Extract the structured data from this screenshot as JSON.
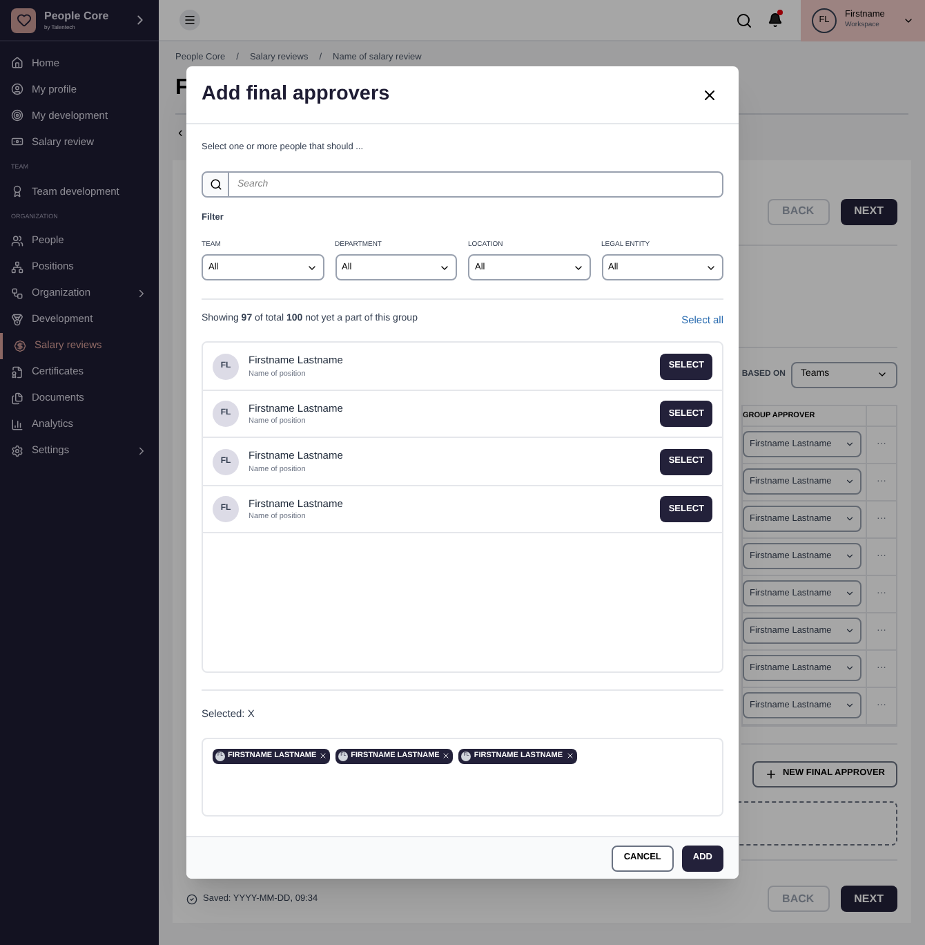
{
  "sidebar": {
    "brand": {
      "name": "People Core",
      "tagline": "by Talentech"
    },
    "sections": [
      {
        "items": [
          {
            "label": "Home",
            "selected": false,
            "expandable": false
          },
          {
            "label": "My profile",
            "selected": false,
            "expandable": false
          },
          {
            "label": "My development",
            "selected": false,
            "expandable": false
          },
          {
            "label": "Salary review",
            "selected": false,
            "expandable": false
          }
        ]
      },
      {
        "heading": "TEAM",
        "items": [
          {
            "label": "Team development",
            "selected": false,
            "expandable": false
          }
        ]
      },
      {
        "heading": "ORGANIZATION",
        "items": [
          {
            "label": "People",
            "selected": false,
            "expandable": false
          },
          {
            "label": "Positions",
            "selected": false,
            "expandable": false
          },
          {
            "label": "Organization",
            "selected": false,
            "expandable": true
          },
          {
            "label": "Development",
            "selected": false,
            "expandable": false
          },
          {
            "label": "Salary reviews",
            "selected": true,
            "expandable": false
          },
          {
            "label": "Certificates",
            "selected": false,
            "expandable": false
          },
          {
            "label": "Documents",
            "selected": false,
            "expandable": false
          },
          {
            "label": "Analytics",
            "selected": false,
            "expandable": false
          },
          {
            "label": "Settings",
            "selected": false,
            "expandable": true
          }
        ]
      }
    ]
  },
  "topbar": {
    "notifications_unread": true,
    "user": {
      "initials": "FL",
      "name": "Firstname",
      "workspace": "Workspace"
    }
  },
  "page": {
    "breadcrumb": [
      "People Core",
      "Salary reviews",
      "Name of salary review"
    ],
    "breadcrumb_separator": "/",
    "title": "F",
    "back": "‹",
    "top_buttons": [
      {
        "label": "BACK",
        "disabled": true
      },
      {
        "label": "NEXT",
        "disabled": false
      }
    ],
    "based_on": {
      "label": "BASED ON",
      "value": "Teams"
    },
    "table": {
      "columns": [
        "GROUP APPROVER"
      ],
      "rows": [
        {
          "approver": "Firstname Lastname",
          "menu": "···"
        },
        {
          "approver": "Firstname Lastname",
          "menu": "···"
        },
        {
          "approver": "Firstname Lastname",
          "menu": "···"
        },
        {
          "approver": "Firstname Lastname",
          "menu": "···"
        },
        {
          "approver": "Firstname Lastname",
          "menu": "···"
        },
        {
          "approver": "Firstname Lastname",
          "menu": "···"
        },
        {
          "approver": "Firstname Lastname",
          "menu": "···"
        },
        {
          "approver": "Firstname Lastname",
          "menu": "···"
        }
      ]
    },
    "new_button": "NEW FINAL APPROVER",
    "saved": "Saved: YYYY-MM-DD, 09:34",
    "bottom_buttons": [
      {
        "label": "BACK",
        "disabled": true
      },
      {
        "label": "NEXT",
        "disabled": false
      }
    ]
  },
  "dialog": {
    "title": "Add final approvers",
    "description": "Select one or more people that should ...",
    "search": {
      "placeholder": "Search"
    },
    "filter_title": "Filter",
    "filters": [
      {
        "label": "TEAM",
        "value": "All"
      },
      {
        "label": "DEPARTMENT",
        "value": "All"
      },
      {
        "label": "LOCATION",
        "value": "All"
      },
      {
        "label": "LEGAL ENTITY",
        "value": "All"
      }
    ],
    "summary": "Showing **97** of total **100** not yet a part of this group",
    "select_all": "Select all",
    "people": [
      {
        "initials": "FL",
        "name": "Firstname Lastname",
        "position": "Name of position",
        "action": "SELECT"
      },
      {
        "initials": "FL",
        "name": "Firstname Lastname",
        "position": "Name of position",
        "action": "SELECT"
      },
      {
        "initials": "FL",
        "name": "Firstname Lastname",
        "position": "Name of position",
        "action": "SELECT"
      },
      {
        "initials": "FL",
        "name": "Firstname Lastname",
        "position": "Name of position",
        "action": "SELECT"
      }
    ],
    "selected_label": "Selected: X",
    "chips": [
      {
        "initials": "FL",
        "name": "FIRSTNAME LASTNAME"
      },
      {
        "initials": "FL",
        "name": "FIRSTNAME LASTNAME"
      },
      {
        "initials": "FL",
        "name": "FIRSTNAME LASTNAME"
      }
    ],
    "buttons": [
      {
        "label": "CANCEL",
        "kind": "secondary"
      },
      {
        "label": "ADD",
        "kind": "primary"
      }
    ]
  }
}
